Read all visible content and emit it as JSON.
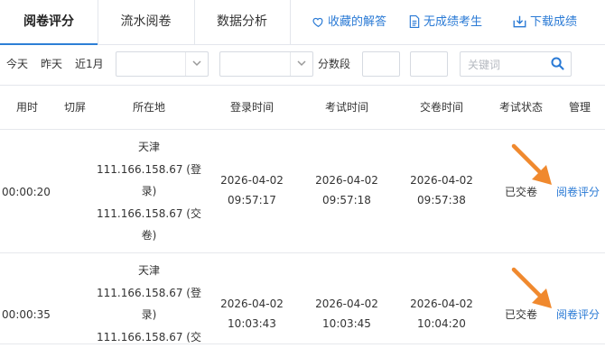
{
  "tabs": [
    {
      "label": "阅卷评分",
      "active": true
    },
    {
      "label": "流水阅卷",
      "active": false
    },
    {
      "label": "数据分析",
      "active": false
    }
  ],
  "header_links": [
    {
      "label": "收藏的解答",
      "icon": "heart-icon"
    },
    {
      "label": "无成绩考生",
      "icon": "document-icon"
    },
    {
      "label": "下载成绩",
      "icon": "download-icon"
    }
  ],
  "filters": {
    "quick": [
      "今天",
      "昨天",
      "近1月"
    ],
    "score_label": "分数段",
    "keyword_placeholder": "关键词"
  },
  "table": {
    "columns": [
      "用时",
      "切屏",
      "所在地",
      "登录时间",
      "考试时间",
      "交卷时间",
      "考试状态",
      "管理"
    ],
    "rows": [
      {
        "duration": "00:00:20",
        "switch": "",
        "location": [
          "天津",
          "111.166.158.67 (登",
          "录)",
          "111.166.158.67 (交",
          "卷)"
        ],
        "login_date": "2026-04-02",
        "login_time": "09:57:17",
        "exam_date": "2026-04-02",
        "exam_time": "09:57:18",
        "submit_date": "2026-04-02",
        "submit_time": "09:57:38",
        "status": "已交卷",
        "action": "阅卷评分"
      },
      {
        "duration": "00:00:35",
        "switch": "",
        "location": [
          "天津",
          "111.166.158.67 (登",
          "录)",
          "111.166.158.67 (交"
        ],
        "login_date": "2026-04-02",
        "login_time": "10:03:43",
        "exam_date": "2026-04-02",
        "exam_time": "10:03:45",
        "submit_date": "2026-04-02",
        "submit_time": "10:04:20",
        "status": "已交卷",
        "action": "阅卷评分"
      }
    ]
  },
  "colors": {
    "accent": "#2a7ad5",
    "arrow": "#f0892e",
    "border": "#e3e6ec"
  }
}
